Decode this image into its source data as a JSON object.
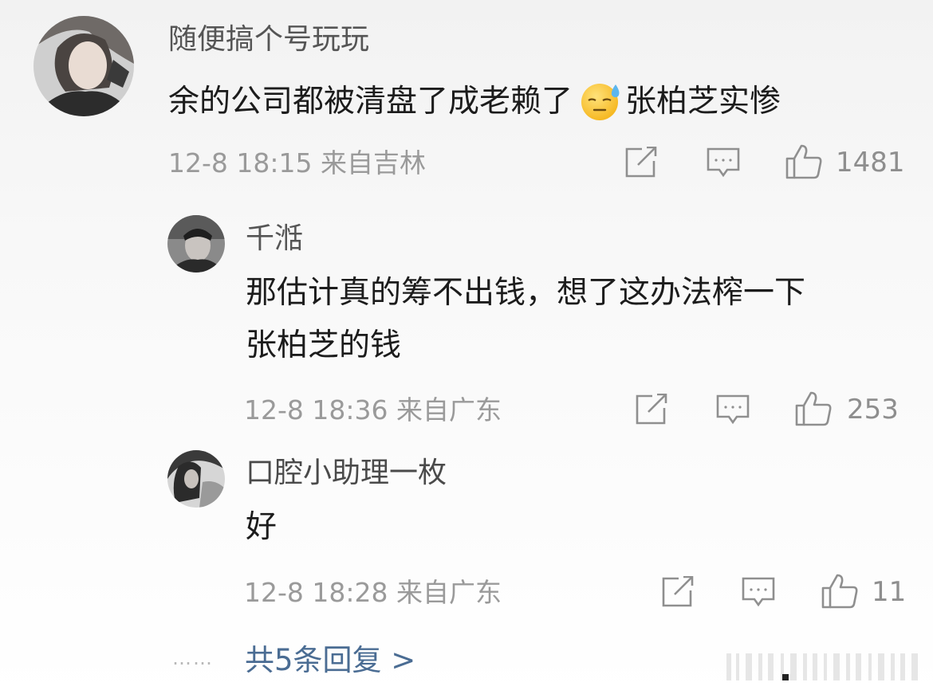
{
  "colors": {
    "link": "#4a6c93",
    "meta": "#9a9a9a",
    "icon": "#8f8f8f"
  },
  "comment": {
    "username": "随便搞个号玩玩",
    "text_before_emoji": "余的公司都被清盘了成老赖了",
    "emoji": "sweat-smile-emoji",
    "text_after_emoji": "张柏芝实惨",
    "meta": "12-8 18:15 来自吉林",
    "likes": "1481"
  },
  "replies": [
    {
      "username": "千湉",
      "lines": [
        "那估计真的筹不出钱，想了这办法榨一下",
        "张柏芝的钱"
      ],
      "meta": "12-8 18:36 来自广东",
      "likes": "253"
    },
    {
      "username": "口腔小助理一枚",
      "lines": [
        "好"
      ],
      "meta": "12-8 18:28 来自广东",
      "likes": "11"
    }
  ],
  "footer": {
    "dots": "……",
    "more_replies": "共5条回复 >"
  },
  "icons": [
    "share-icon",
    "comment-icon",
    "like-icon"
  ]
}
